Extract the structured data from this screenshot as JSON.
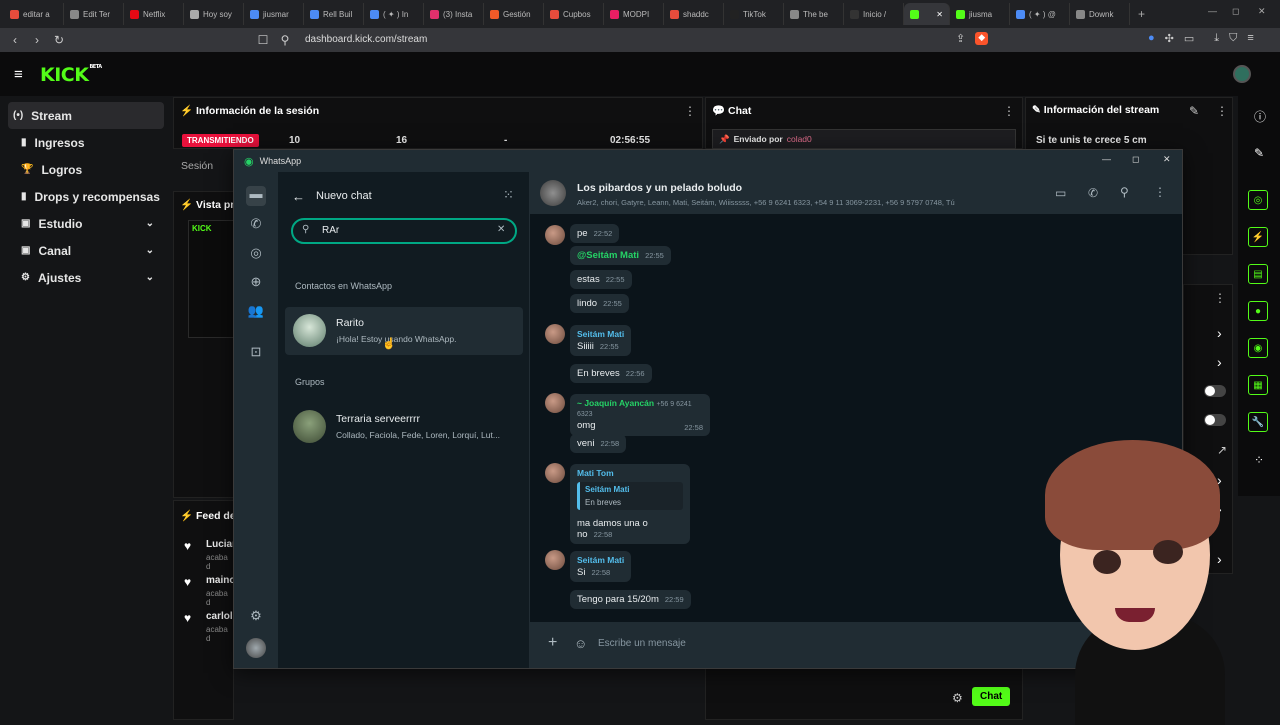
{
  "browser": {
    "tabs": [
      "editar a",
      "Edit Ter",
      "Netflix",
      "Hoy soy",
      "jiusmar",
      "Rell Buil",
      "( ✦ ) In",
      "(3) Insta",
      "Gestión",
      "Cupbos",
      "MODPI",
      "shaddc",
      "TikTok",
      "The be",
      "Inicio /",
      "",
      "jiusma",
      "( ✦ ) @",
      "Downk"
    ],
    "new_tab": "+",
    "url": "dashboard.kick.com/stream"
  },
  "kick": {
    "logo": "KICK",
    "logo_tag": "BETA",
    "nav": [
      {
        "label": "Stream",
        "icon": "(•)"
      },
      {
        "label": "Ingresos",
        "icon": "▮"
      },
      {
        "label": "Logros",
        "icon": "🏆"
      },
      {
        "label": "Drops y recompensas",
        "icon": "▮"
      },
      {
        "label": "Estudio",
        "icon": "▣",
        "chev": "⌄"
      },
      {
        "label": "Canal",
        "icon": "▣",
        "chev": "⌄"
      },
      {
        "label": "Ajustes",
        "icon": "⚙",
        "chev": "⌄"
      }
    ],
    "session": {
      "title": "Información de la sesión",
      "badge": "TRANSMITIENDO",
      "label": "Sesión",
      "stats": [
        "10",
        "16",
        "-",
        "02:56:55"
      ]
    },
    "chat": {
      "title": "Chat",
      "pinned_prefix": "Enviado por",
      "pinned_user": "colad0",
      "button": "Chat"
    },
    "stream_info": {
      "title": "Información del stream",
      "stream_title": "Si te unis te crece 5 cm"
    },
    "preview": {
      "title": "Vista pre"
    },
    "feed": {
      "title": "Feed de a",
      "items": [
        {
          "name": "Lucian",
          "sub": "acaba d"
        },
        {
          "name": "mainol",
          "sub": "acaba d"
        },
        {
          "name": "carlolo",
          "sub": "acaba d"
        }
      ]
    }
  },
  "whatsapp": {
    "window_title": "WhatsApp",
    "sidebar": {
      "title": "Nuevo chat",
      "search_value": "RAr",
      "section_contacts": "Contactos en WhatsApp",
      "contacts": [
        {
          "name": "Rarito",
          "status": "¡Hola! Estoy usando WhatsApp."
        }
      ],
      "section_groups": "Grupos",
      "groups": [
        {
          "name": "Terraria serveerrrr",
          "members": "Collado, Faciola, Fede, Loren, Lorquí, Lut..."
        }
      ]
    },
    "chat": {
      "name": "Los pibardos y un pelado boludo",
      "members": "Aker2, chori, Gatyre, Leann, Mati, Seitám, Wiiisssss, +56 9 6241 6323, +54 9 11 3069-2231, +56 9 5797 0748, Tú",
      "input_placeholder": "Escribe un mensaje",
      "messages": [
        {
          "text": "pe",
          "time": "22:52"
        },
        {
          "text": "@Seitám Mati",
          "time": "22:55"
        },
        {
          "text": "estas",
          "time": "22:55"
        },
        {
          "text": "lindo",
          "time": "22:55"
        },
        {
          "sender": "Seitám Mati",
          "text": "Siiiii",
          "time": "22:55"
        },
        {
          "text": "En breves",
          "time": "22:56"
        },
        {
          "sender": "~ Joaquín Ayancán",
          "phone": "+56 9 6241 6323",
          "text": "omg",
          "time": "22:58"
        },
        {
          "text": "veni",
          "time": "22:58"
        },
        {
          "sender": "Mati Tom",
          "quote_sender": "Seitám Mati",
          "quote_text": "En breves",
          "text": "ma damos una o no",
          "time": "22:58"
        },
        {
          "sender": "Seitám Mati",
          "text": "Si",
          "time": "22:58"
        },
        {
          "text": "Tengo para 15/20m",
          "time": "22:59"
        }
      ]
    }
  },
  "colors": {
    "kick_green": "#53fc18",
    "wa_green": "#00a884",
    "live_red": "#e9113c"
  }
}
